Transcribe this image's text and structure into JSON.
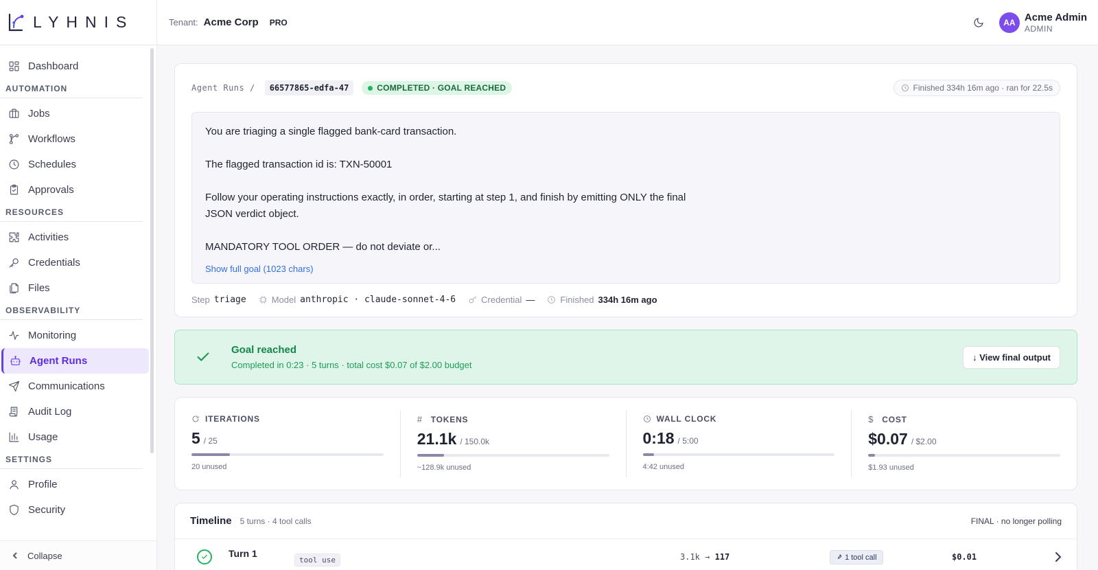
{
  "brand": {
    "name": "LYHNIS"
  },
  "tenant": {
    "label": "Tenant:",
    "name": "Acme Corp",
    "plan": "PRO"
  },
  "user": {
    "initials": "AA",
    "name": "Acme Admin",
    "role": "ADMIN"
  },
  "sidebar": {
    "top": [
      {
        "label": "Dashboard",
        "icon": "dashboard-icon"
      }
    ],
    "sections": [
      {
        "title": "AUTOMATION",
        "items": [
          {
            "label": "Jobs",
            "icon": "briefcase-icon"
          },
          {
            "label": "Workflows",
            "icon": "workflow-icon"
          },
          {
            "label": "Schedules",
            "icon": "clock-icon"
          },
          {
            "label": "Approvals",
            "icon": "clipboard-check-icon"
          }
        ]
      },
      {
        "title": "RESOURCES",
        "items": [
          {
            "label": "Activities",
            "icon": "puzzle-icon"
          },
          {
            "label": "Credentials",
            "icon": "key-icon"
          },
          {
            "label": "Files",
            "icon": "files-icon"
          }
        ]
      },
      {
        "title": "OBSERVABILITY",
        "items": [
          {
            "label": "Monitoring",
            "icon": "activity-icon"
          },
          {
            "label": "Agent Runs",
            "icon": "bot-icon",
            "active": true
          },
          {
            "label": "Communications",
            "icon": "send-icon"
          },
          {
            "label": "Audit Log",
            "icon": "scroll-icon"
          },
          {
            "label": "Usage",
            "icon": "bar-chart-icon"
          }
        ]
      },
      {
        "title": "SETTINGS",
        "items": [
          {
            "label": "Profile",
            "icon": "user-icon"
          },
          {
            "label": "Security",
            "icon": "shield-icon"
          }
        ]
      }
    ],
    "collapse_label": "Collapse"
  },
  "run": {
    "breadcrumb": "Agent Runs /",
    "id": "66577865-edfa-47",
    "status": "COMPLETED · GOAL REACHED",
    "finished_summary": "Finished 334h 16m ago · ran for 22.5s",
    "goal_lines": [
      "You are triaging a single flagged bank-card transaction.",
      "The flagged transaction id is: TXN-50001",
      "Follow your operating instructions exactly, in order, starting at step 1, and finish by emitting ONLY the final",
      "JSON verdict object.",
      "MANDATORY TOOL ORDER — do not deviate or..."
    ],
    "show_full_goal": "Show full goal (1023 chars)",
    "meta": {
      "step_label": "Step",
      "step_value": "triage",
      "model_label": "Model",
      "model_value": "anthropic · claude-sonnet-4-6",
      "credential_label": "Credential",
      "credential_value": "—",
      "finished_label": "Finished",
      "finished_value": "334h 16m ago"
    }
  },
  "goal_banner": {
    "title": "Goal reached",
    "subtitle": "Completed in 0:23 · 5 turns · total cost $0.07 of $2.00 budget",
    "button": "↓ View final output"
  },
  "stats": [
    {
      "label": "ITERATIONS",
      "icon": "refresh-icon",
      "value": "5",
      "max": "/ 25",
      "used_fraction": 0.2,
      "unused": "20 unused"
    },
    {
      "label": "TOKENS",
      "icon": "hash-icon",
      "value": "21.1k",
      "max": "/ 150.0k",
      "used_fraction": 0.14,
      "unused": "~128.9k unused"
    },
    {
      "label": "WALL CLOCK",
      "icon": "clock-icon",
      "value": "0:18",
      "max": "/ 5:00",
      "used_fraction": 0.06,
      "unused": "4:42 unused"
    },
    {
      "label": "COST",
      "icon": "dollar-icon",
      "value": "$0.07",
      "max": "/ $2.00",
      "used_fraction": 0.035,
      "unused": "$1.93 unused"
    }
  ],
  "timeline": {
    "title": "Timeline",
    "subtitle": "5 turns · 4 tool calls",
    "status": "FINAL · no longer polling",
    "rows": [
      {
        "turn": "Turn 1",
        "kind": "tool use",
        "tokens_in": "3.1k",
        "arrow": "→",
        "tokens_out": "117",
        "tools": "1 tool call",
        "cost": "$0.01"
      }
    ]
  },
  "colors": {
    "accent": "#6a3ee6",
    "success": "#22b35e",
    "success_bg": "#dff5ea"
  }
}
